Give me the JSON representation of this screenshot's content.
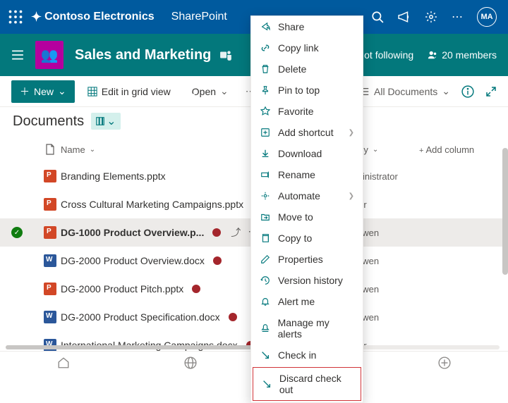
{
  "suite": {
    "brand": "Contoso Electronics",
    "app": "SharePoint",
    "avatar": "MA"
  },
  "site": {
    "name": "Sales and Marketing",
    "follow": "Not following",
    "members": "20 members"
  },
  "toolbar": {
    "new_label": "New",
    "edit_grid": "Edit in grid view",
    "open": "Open",
    "view": "All Documents"
  },
  "library": {
    "title": "Documents"
  },
  "columns": {
    "name": "Name",
    "modified_by": "Modified By",
    "add": "Add column"
  },
  "rows": [
    {
      "icon": "pp",
      "name": "Branding Elements.pptx",
      "co": false,
      "modby": "MOD Administrator",
      "sel": false
    },
    {
      "icon": "pp",
      "name": "Cross Cultural Marketing Campaigns.pptx",
      "co": true,
      "modby": "Alex Wilber",
      "sel": false
    },
    {
      "icon": "pp",
      "name": "DG-1000 Product Overview.p...",
      "co": true,
      "modby": "Megan Bowen",
      "sel": true
    },
    {
      "icon": "wd",
      "name": "DG-2000 Product Overview.docx",
      "co": true,
      "modby": "Megan Bowen",
      "sel": false
    },
    {
      "icon": "pp",
      "name": "DG-2000 Product Pitch.pptx",
      "co": true,
      "modby": "Megan Bowen",
      "sel": false
    },
    {
      "icon": "wd",
      "name": "DG-2000 Product Specification.docx",
      "co": true,
      "modby": "Megan Bowen",
      "sel": false
    },
    {
      "icon": "wd",
      "name": "International Marketing Campaigns.docx",
      "co": true,
      "modby": "Alex Wilber",
      "sel": false
    }
  ],
  "context_menu": [
    {
      "icon": "share",
      "label": "Share"
    },
    {
      "icon": "link",
      "label": "Copy link"
    },
    {
      "icon": "trash",
      "label": "Delete"
    },
    {
      "icon": "pin",
      "label": "Pin to top"
    },
    {
      "icon": "star",
      "label": "Favorite"
    },
    {
      "icon": "shortcut",
      "label": "Add shortcut",
      "sub": true
    },
    {
      "icon": "download",
      "label": "Download"
    },
    {
      "icon": "rename",
      "label": "Rename"
    },
    {
      "icon": "flow",
      "label": "Automate",
      "sub": true
    },
    {
      "icon": "move",
      "label": "Move to"
    },
    {
      "icon": "copy",
      "label": "Copy to"
    },
    {
      "icon": "props",
      "label": "Properties"
    },
    {
      "icon": "history",
      "label": "Version history"
    },
    {
      "icon": "bell",
      "label": "Alert me"
    },
    {
      "icon": "alerts",
      "label": "Manage my alerts"
    },
    {
      "icon": "checkin",
      "label": "Check in"
    },
    {
      "icon": "discard",
      "label": "Discard check out",
      "danger": true
    }
  ]
}
